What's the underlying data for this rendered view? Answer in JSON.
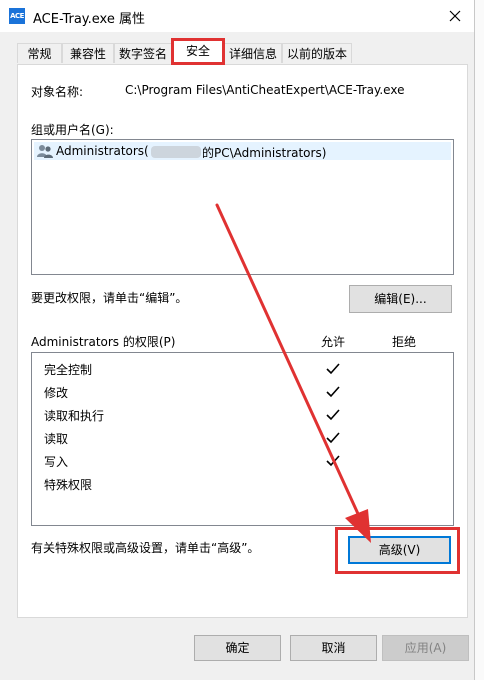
{
  "window": {
    "title": "ACE-Tray.exe 属性",
    "icon_text": "ACE"
  },
  "tabs": [
    {
      "label": "常规",
      "active": false
    },
    {
      "label": "兼容性",
      "active": false
    },
    {
      "label": "数字签名",
      "active": false
    },
    {
      "label": "安全",
      "active": true
    },
    {
      "label": "详细信息",
      "active": false
    },
    {
      "label": "以前的版本",
      "active": false
    }
  ],
  "security": {
    "object_name_label": "对象名称:",
    "object_name_value": "C:\\Program Files\\AntiCheatExpert\\ACE-Tray.exe",
    "group_label": "组或用户名(G):",
    "groups": [
      {
        "name": "Administrators",
        "detail_blurred": "(",
        "detail_tail": "的PC\\Administrators)"
      }
    ],
    "edit_hint": "要更改权限，请单击“编辑”。",
    "edit_button": "编辑(E)...",
    "perm_label": "Administrators 的权限(P)",
    "allow_header": "允许",
    "deny_header": "拒绝",
    "permissions": [
      {
        "name": "完全控制",
        "allow": true
      },
      {
        "name": "修改",
        "allow": true
      },
      {
        "name": "读取和执行",
        "allow": true
      },
      {
        "name": "读取",
        "allow": true
      },
      {
        "name": "写入",
        "allow": true
      },
      {
        "name": "特殊权限",
        "allow": false
      }
    ],
    "advanced_hint": "有关特殊权限或高级设置，请单击“高级”。",
    "advanced_button": "高级(V)"
  },
  "footer": {
    "ok": "确定",
    "cancel": "取消",
    "apply": "应用(A)"
  },
  "annotation_color": "#e03232"
}
